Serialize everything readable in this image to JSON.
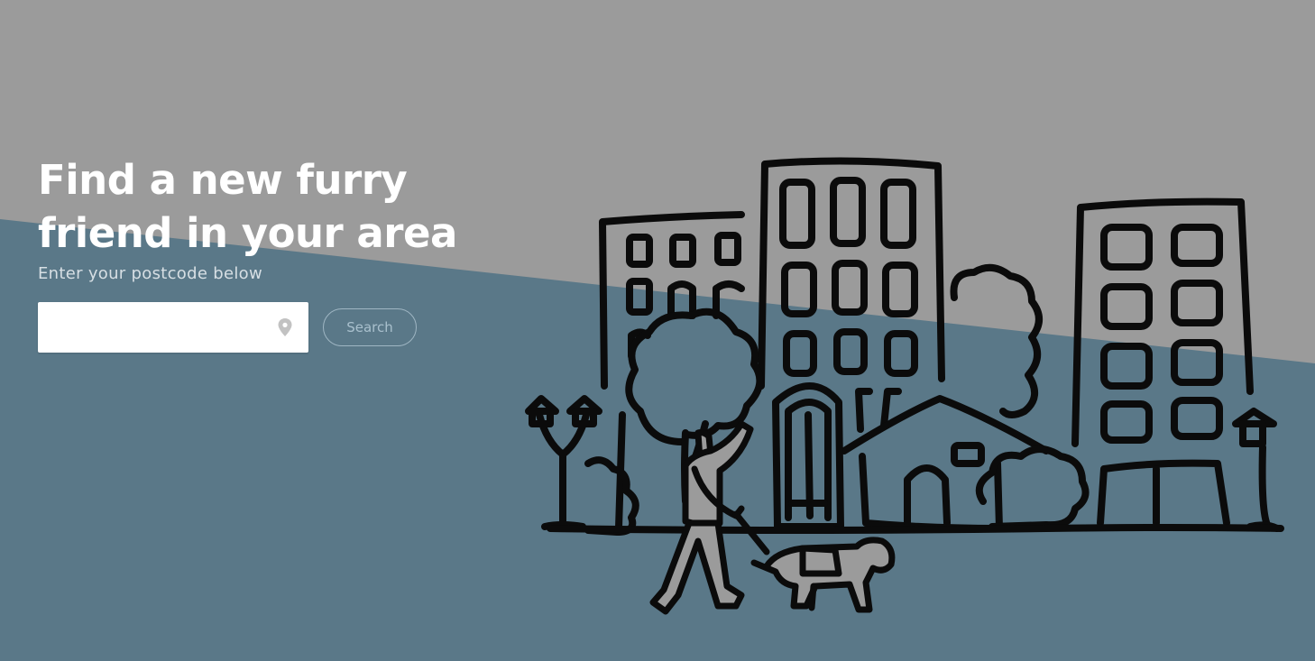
{
  "hero": {
    "headline_line1": "Find a new furry",
    "headline_line2": "friend in your area",
    "subtitle": "Enter your postcode below"
  },
  "search": {
    "postcode_value": "",
    "postcode_placeholder": "",
    "button_label": "Search",
    "location_icon": "map-pin-icon"
  },
  "illustration": {
    "name": "city-street-dog-walker-illustration"
  },
  "colors": {
    "top_background": "#9b9b9b",
    "bottom_background": "#5a7888",
    "text_primary": "#ffffff",
    "text_secondary": "#d7dfe4",
    "button_border": "#9fb6c3",
    "line_art": "#0b0b0b"
  }
}
